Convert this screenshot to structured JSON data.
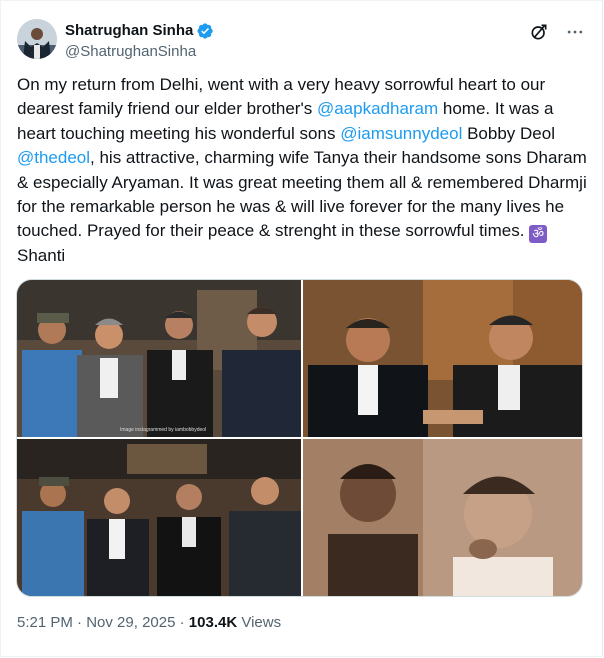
{
  "author": {
    "display_name": "Shatrughan Sinha",
    "handle": "@ShatrughanSinha",
    "verified": true,
    "avatar_icon": "avatar-photo"
  },
  "header_icons": [
    "grok-icon",
    "more-icon"
  ],
  "tweet": {
    "text_1": "On my return from Delhi, went with a  very heavy sorrowful heart to our dearest family friend our elder brother's ",
    "mention_1": "@aapkadharam",
    "text_2": " home. It was a heart touching meeting his wonderful sons ",
    "mention_2": "@iamsunnydeol",
    "text_3": " Bobby Deol ",
    "mention_3": "@thedeol",
    "text_4": ", his attractive,  charming wife Tanya their handsome sons Dharam & especially Aryaman. It was great meeting them all & remembered Dharmji for the remarkable person he was & will live forever for the many lives he touched. Prayed for their peace & strenght in these sorrowful times. ",
    "om_symbol": "ॐ",
    "text_5": "Shanti"
  },
  "media": {
    "photo_credit": "Image instagrammed by iambobbydeol",
    "photos": [
      "group-photo-1",
      "two-men-photo",
      "group-photo-2",
      "sepia-photo"
    ]
  },
  "meta": {
    "time": "5:21 PM",
    "separator_1": " · ",
    "date": "Nov 29, 2025",
    "separator_2": " · ",
    "views_count": "103.4K",
    "views_label": " Views"
  },
  "colors": {
    "accent": "#1d9bf0",
    "text": "#0f1419",
    "secondary": "#536471",
    "om_badge": "#7e5cc7"
  }
}
